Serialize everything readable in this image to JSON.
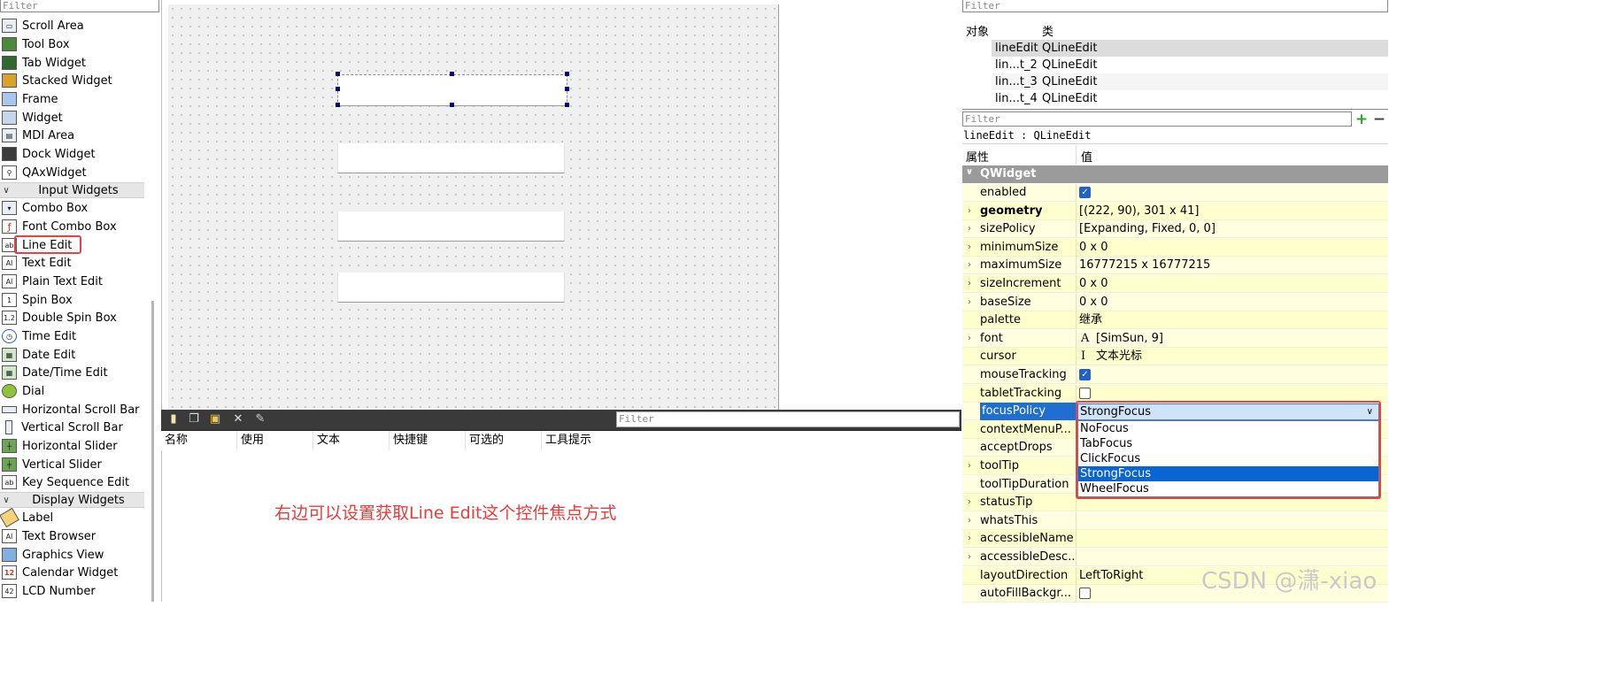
{
  "widget_box": {
    "filter_placeholder": "Filter",
    "items": [
      {
        "label": "Scroll Area",
        "icon": "scroll-area-icon"
      },
      {
        "label": "Tool Box",
        "icon": "tool-box-icon"
      },
      {
        "label": "Tab Widget",
        "icon": "tab-widget-icon"
      },
      {
        "label": "Stacked Widget",
        "icon": "stacked-widget-icon"
      },
      {
        "label": "Frame",
        "icon": "frame-icon"
      },
      {
        "label": "Widget",
        "icon": "widget-icon"
      },
      {
        "label": "MDI Area",
        "icon": "mdi-area-icon"
      },
      {
        "label": "Dock Widget",
        "icon": "dock-widget-icon"
      },
      {
        "label": "QAxWidget",
        "icon": "qaxwidget-icon"
      }
    ],
    "category_input": "Input Widgets",
    "input_items": [
      {
        "label": "Combo Box",
        "icon": "combo-box-icon"
      },
      {
        "label": "Font Combo Box",
        "icon": "font-combo-box-icon"
      },
      {
        "label": "Line Edit",
        "icon": "line-edit-icon"
      },
      {
        "label": "Text Edit",
        "icon": "text-edit-icon"
      },
      {
        "label": "Plain Text Edit",
        "icon": "plain-text-edit-icon"
      },
      {
        "label": "Spin Box",
        "icon": "spin-box-icon"
      },
      {
        "label": "Double Spin Box",
        "icon": "double-spin-box-icon"
      },
      {
        "label": "Time Edit",
        "icon": "time-edit-icon"
      },
      {
        "label": "Date Edit",
        "icon": "date-edit-icon"
      },
      {
        "label": "Date/Time Edit",
        "icon": "date-time-edit-icon"
      },
      {
        "label": "Dial",
        "icon": "dial-icon"
      },
      {
        "label": "Horizontal Scroll Bar",
        "icon": "horizontal-scroll-bar-icon"
      },
      {
        "label": "Vertical Scroll Bar",
        "icon": "vertical-scroll-bar-icon"
      },
      {
        "label": "Horizontal Slider",
        "icon": "horizontal-slider-icon"
      },
      {
        "label": "Vertical Slider",
        "icon": "vertical-slider-icon"
      },
      {
        "label": "Key Sequence Edit",
        "icon": "key-sequence-edit-icon"
      }
    ],
    "category_display": "Display Widgets",
    "display_items": [
      {
        "label": "Label",
        "icon": "label-icon"
      },
      {
        "label": "Text Browser",
        "icon": "text-browser-icon"
      },
      {
        "label": "Graphics View",
        "icon": "graphics-view-icon"
      },
      {
        "label": "Calendar Widget",
        "icon": "calendar-widget-icon"
      },
      {
        "label": "LCD Number",
        "icon": "lcd-number-icon"
      }
    ]
  },
  "action_editor": {
    "filter_placeholder": "Filter",
    "columns": [
      "名称",
      "使用",
      "文本",
      "快捷键",
      "可选的",
      "工具提示"
    ]
  },
  "annotation": "右边可以设置获取Line Edit这个控件焦点方式",
  "object_inspector": {
    "filter_placeholder": "Filter",
    "col_object": "对象",
    "col_class": "类",
    "rows": [
      {
        "object": "lineEdit",
        "class": "QLineEdit"
      },
      {
        "object": "lin...t_2",
        "class": "QLineEdit"
      },
      {
        "object": "lin...t_3",
        "class": "QLineEdit"
      },
      {
        "object": "lin...t_4",
        "class": "QLineEdit"
      }
    ]
  },
  "property_editor": {
    "filter_placeholder": "Filter",
    "class_label": "lineEdit : QLineEdit",
    "col_property": "属性",
    "col_value": "值",
    "group": "QWidget",
    "rows": [
      {
        "name": "enabled",
        "value": "",
        "checkbox": true
      },
      {
        "name": "geometry",
        "value": "[(222, 90), 301 x 41]",
        "bold": true,
        "expand": true
      },
      {
        "name": "sizePolicy",
        "value": "[Expanding, Fixed, 0, 0]",
        "expand": true
      },
      {
        "name": "minimumSize",
        "value": "0 x 0",
        "expand": true
      },
      {
        "name": "maximumSize",
        "value": "16777215 x 16777215",
        "expand": true
      },
      {
        "name": "sizeIncrement",
        "value": "0 x 0",
        "expand": true
      },
      {
        "name": "baseSize",
        "value": "0 x 0",
        "expand": true
      },
      {
        "name": "palette",
        "value": "继承"
      },
      {
        "name": "font",
        "value": "[SimSun, 9]",
        "expand": true,
        "icon": "A"
      },
      {
        "name": "cursor",
        "value": "文本光标",
        "icon": "I"
      },
      {
        "name": "mouseTracking",
        "value": "",
        "checkbox": true
      },
      {
        "name": "tabletTracking",
        "value": "",
        "checkbox": false
      },
      {
        "name": "focusPolicy",
        "value": "StrongFocus"
      },
      {
        "name": "contextMenuP...",
        "value": ""
      },
      {
        "name": "acceptDrops",
        "value": ""
      },
      {
        "name": "toolTip",
        "value": "",
        "expand": true
      },
      {
        "name": "toolTipDuration",
        "value": ""
      },
      {
        "name": "statusTip",
        "value": "",
        "expand": true
      },
      {
        "name": "whatsThis",
        "value": "",
        "expand": true
      },
      {
        "name": "accessibleName",
        "value": "",
        "expand": true
      },
      {
        "name": "accessibleDesc...",
        "value": "",
        "expand": true
      },
      {
        "name": "layoutDirection",
        "value": "LeftToRight"
      },
      {
        "name": "autoFillBackgr...",
        "value": "",
        "checkbox": false
      }
    ],
    "focus_policy": {
      "current": "StrongFocus",
      "options": [
        "NoFocus",
        "TabFocus",
        "ClickFocus",
        "StrongFocus",
        "WheelFocus"
      ],
      "selected_index": 3
    }
  },
  "watermark": "CSDN @潇-xiao",
  "colors": {
    "accent": "#1f6fd0",
    "highlight_red": "#e8414a",
    "property_bg": "#ffffe0",
    "group_bg": "#9b9b9b"
  }
}
